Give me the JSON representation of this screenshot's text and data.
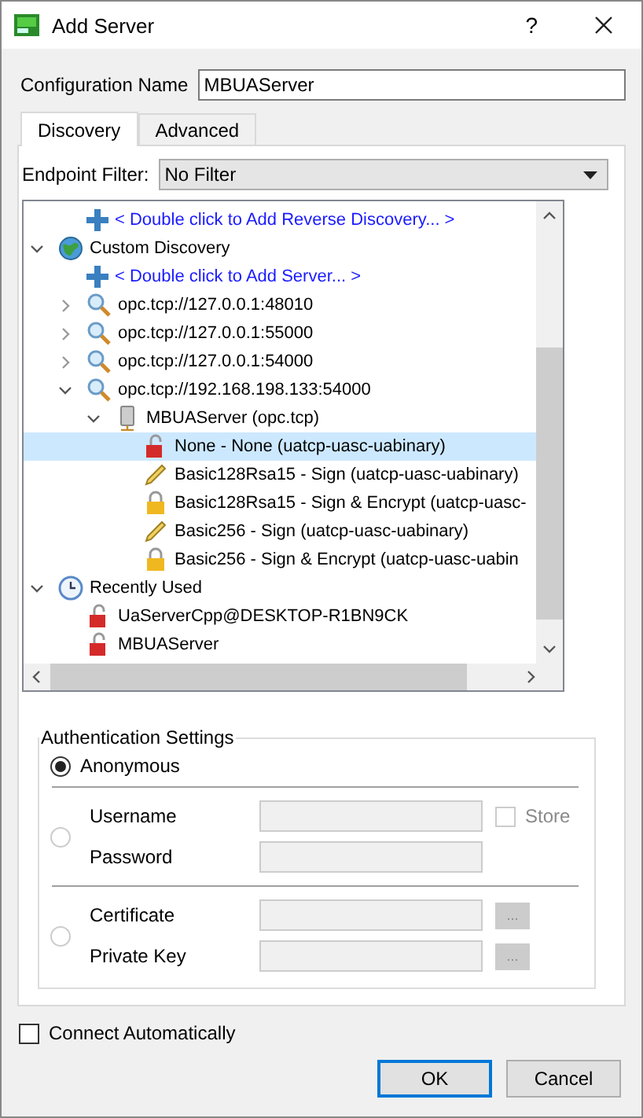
{
  "window": {
    "title": "Add Server",
    "help": "?"
  },
  "configuration_name": {
    "label": "Configuration Name",
    "value": "MBUAServer"
  },
  "tabs": [
    {
      "label": "Discovery",
      "selected": true
    },
    {
      "label": "Advanced",
      "selected": false
    }
  ],
  "endpoint_filter": {
    "label": "Endpoint Filter:",
    "value": "No Filter"
  },
  "tree": {
    "items": [
      {
        "kind": "hidden",
        "children": [
          {
            "kind": "add",
            "text": "< Double click to Add Reverse Discovery... >",
            "selected": false
          }
        ]
      },
      {
        "kind": "discovery-group",
        "text": "Custom Discovery",
        "expanded": true,
        "selected": false,
        "children": [
          {
            "kind": "add",
            "text": "< Double click to Add Server... >",
            "selected": false
          },
          {
            "kind": "url",
            "text": "opc.tcp://127.0.0.1:48010",
            "expanded": false,
            "selected": false
          },
          {
            "kind": "url",
            "text": "opc.tcp://127.0.0.1:55000",
            "expanded": false,
            "selected": false
          },
          {
            "kind": "url",
            "text": "opc.tcp://127.0.0.1:54000",
            "expanded": false,
            "selected": false
          },
          {
            "kind": "url",
            "text": "opc.tcp://192.168.198.133:54000",
            "expanded": true,
            "selected": false,
            "children": [
              {
                "kind": "server",
                "text": "MBUAServer (opc.tcp)",
                "expanded": true,
                "selected": false,
                "children": [
                  {
                    "kind": "endpoint-none",
                    "text": "None - None (uatcp-uasc-uabinary)",
                    "selected": true
                  },
                  {
                    "kind": "endpoint-sign",
                    "text": "Basic128Rsa15 - Sign (uatcp-uasc-uabinary)",
                    "selected": false
                  },
                  {
                    "kind": "endpoint-encrypt",
                    "text": "Basic128Rsa15 - Sign & Encrypt (uatcp-uasc-",
                    "selected": false
                  },
                  {
                    "kind": "endpoint-sign",
                    "text": "Basic256 - Sign (uatcp-uasc-uabinary)",
                    "selected": false
                  },
                  {
                    "kind": "endpoint-encrypt",
                    "text": "Basic256 - Sign & Encrypt (uatcp-uasc-uabin",
                    "selected": false
                  }
                ]
              }
            ]
          }
        ]
      },
      {
        "kind": "recent-group",
        "text": "Recently Used",
        "expanded": true,
        "selected": false,
        "children": [
          {
            "kind": "recent",
            "text": "UaServerCpp@DESKTOP-R1BN9CK",
            "selected": false
          },
          {
            "kind": "recent",
            "text": "MBUAServer",
            "selected": false
          }
        ]
      }
    ]
  },
  "authentication": {
    "title": "Authentication Settings",
    "options": [
      {
        "kind": "anonymous",
        "label": "Anonymous",
        "selected": true
      },
      {
        "kind": "user",
        "selected": false,
        "fields": [
          {
            "label": "Username"
          },
          {
            "label": "Password"
          }
        ],
        "store": {
          "label": "Store",
          "checked": false
        }
      },
      {
        "kind": "certificate",
        "selected": false,
        "fields": [
          {
            "label": "Certificate",
            "browse": "..."
          },
          {
            "label": "Private Key",
            "browse": "..."
          }
        ]
      }
    ]
  },
  "connect_automatically": {
    "label": "Connect Automatically",
    "checked": false
  },
  "buttons": [
    {
      "label": "OK",
      "default": true
    },
    {
      "label": "Cancel",
      "default": false
    }
  ]
}
